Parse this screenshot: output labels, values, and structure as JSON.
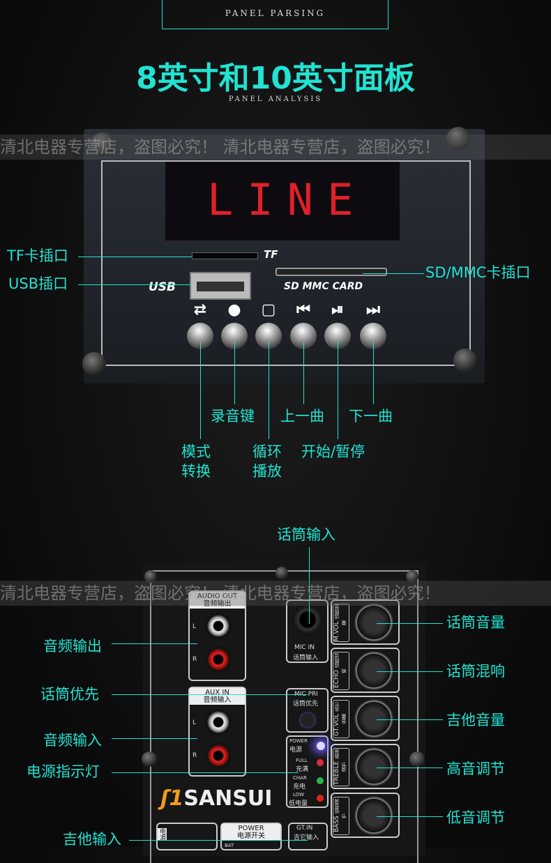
{
  "header": {
    "subtitle_top": "PANEL PARSING",
    "title": "8英寸和10英寸面板",
    "subtitle": "PANEL ANALYSIS"
  },
  "watermark": "清北电器专营店，盗图必究！   清北电器专营店，盗图必究！",
  "panel1": {
    "display": "LINE",
    "tf": "TF",
    "usb": "USB",
    "sd": "SD MMC CARD",
    "icons": [
      "mode-switch-icon",
      "record-icon",
      "repeat-icon",
      "previous-icon",
      "play-pause-icon",
      "next-icon"
    ],
    "labels": {
      "tf": "TF卡插口",
      "usb": "USB插口",
      "sd": "SD/MMC卡插口",
      "record": "录音键",
      "prev": "上一曲",
      "next": "下一曲",
      "mode": [
        "模式",
        "转换"
      ],
      "repeat": [
        "循环",
        "播放"
      ],
      "play": "开始/暂停"
    }
  },
  "panel2": {
    "audio_out": {
      "en": "AUDIO OUT",
      "cn": "音频输出",
      "l": "L",
      "r": "R"
    },
    "aux_in": {
      "en": "AUX  IN",
      "cn": "音频输入",
      "l": "L",
      "r": "R"
    },
    "mic_in": {
      "en": "MIC  IN",
      "cn": "话筒输入"
    },
    "mic_pri": {
      "en": "MIC PRI",
      "cn": "话筒优先"
    },
    "leds": [
      {
        "en": "POWER",
        "cn": "电源",
        "color": "#b9b6ff"
      },
      {
        "en": "FULL",
        "cn": "充满",
        "color": "#e02a3a"
      },
      {
        "en": "CHAR",
        "cn": "充电",
        "color": "#2fb24a"
      },
      {
        "en": "LOW",
        "cn": "低电量",
        "color": "#e0231e"
      }
    ],
    "knobs": [
      {
        "en": "M.VOL",
        "cn": "话筒音量"
      },
      {
        "en": "ECHO",
        "cn": "话筒混响"
      },
      {
        "en": "GT.VOL",
        "cn": "吉它音量"
      },
      {
        "en": "TREBLE",
        "cn": "高音调节"
      },
      {
        "en": "BASS",
        "cn": "低音调节"
      }
    ],
    "brand": "SANSUI",
    "power": {
      "en": "POWER",
      "cn": "电源开关",
      "bat": "BAT"
    },
    "gt_in": {
      "en": "GT.IN",
      "cn": "吉它输入"
    },
    "power_side": "电源",
    "labels": {
      "mic_in": "话筒输入",
      "audio_out": "音频输出",
      "mic_pri": "话筒优先",
      "aux_in": "音频输入",
      "power_led": "电源指示灯",
      "gt_in": "吉他输入",
      "m_vol": "话筒音量",
      "echo": "话筒混响",
      "gt_vol": "吉他音量",
      "treble": "高音调节",
      "bass": "低音调节"
    }
  }
}
